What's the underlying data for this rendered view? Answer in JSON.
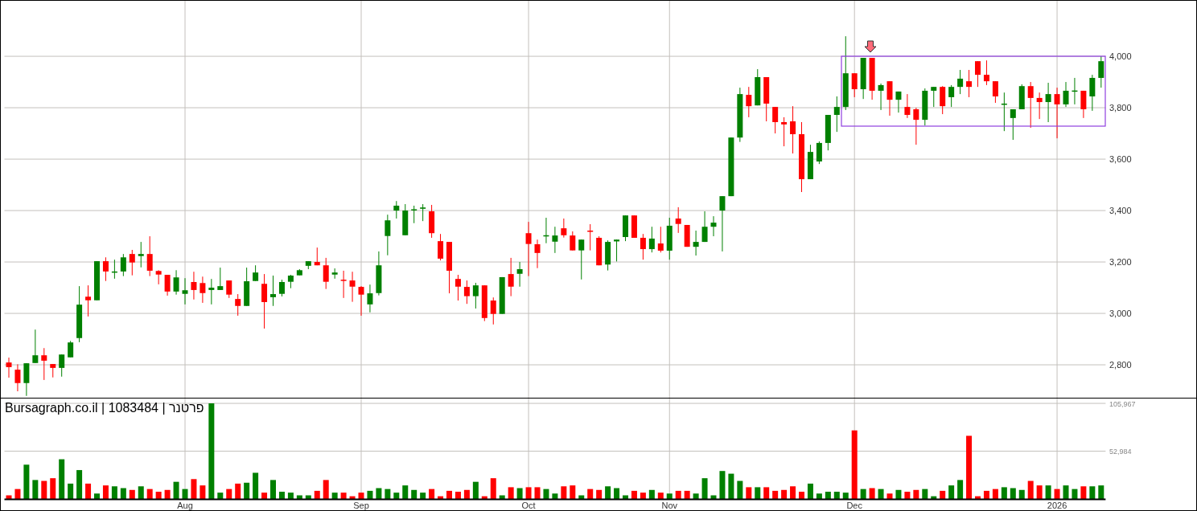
{
  "price_chart": {
    "chart_data": {
      "type": "candlestick",
      "grid": true,
      "ylim": [
        2672,
        4219
      ],
      "yticks": [
        {
          "value": 2800,
          "label": "2,800"
        },
        {
          "value": 3000,
          "label": "3,000"
        },
        {
          "value": 3200,
          "label": "3,200"
        },
        {
          "value": 3400,
          "label": "3,400"
        },
        {
          "value": 3600,
          "label": "3,600"
        },
        {
          "value": 3800,
          "label": "3,800"
        },
        {
          "value": 4000,
          "label": "4,000"
        }
      ],
      "categories": [
        null,
        null,
        null,
        null,
        null,
        null,
        null,
        null,
        null,
        null,
        null,
        null,
        null,
        null,
        null,
        null,
        null,
        null,
        null,
        null,
        null,
        null,
        null,
        null,
        null,
        null,
        null,
        null,
        null,
        null,
        null,
        null,
        null,
        null,
        null,
        null,
        null,
        null,
        null,
        null,
        null,
        null,
        null,
        null,
        null,
        null,
        null,
        null,
        null,
        null,
        null,
        null,
        null,
        null,
        null,
        null,
        null,
        null,
        null,
        null,
        null,
        null,
        null,
        null,
        null,
        null,
        null,
        null,
        null,
        null,
        null,
        null,
        null,
        null,
        null,
        null,
        null,
        null,
        null,
        null,
        null,
        null,
        null,
        null,
        null,
        null,
        null,
        null,
        null,
        null,
        null,
        null,
        null,
        null,
        null,
        null,
        null,
        null,
        null,
        null,
        null,
        null,
        null,
        null,
        null,
        null,
        null,
        null,
        null,
        null,
        null,
        null,
        null,
        null,
        null,
        null,
        null,
        null,
        null,
        null,
        null,
        null,
        null,
        null,
        null
      ],
      "ohlc": [
        [
          2809,
          2828,
          2750,
          2791
        ],
        [
          2781,
          2802,
          2697,
          2729
        ],
        [
          2729,
          2806,
          2679,
          2806
        ],
        [
          2807,
          2937,
          2807,
          2837
        ],
        [
          2837,
          2865,
          2741,
          2816
        ],
        [
          2803,
          2803,
          2751,
          2788
        ],
        [
          2788,
          2840,
          2754,
          2840
        ],
        [
          2829,
          2893,
          2829,
          2887
        ],
        [
          2904,
          3106,
          2888,
          3034
        ],
        [
          3065,
          3109,
          2988,
          3051
        ],
        [
          3051,
          3203,
          3051,
          3203
        ],
        [
          3203,
          3218,
          3126,
          3163
        ],
        [
          3160,
          3209,
          3135,
          3163
        ],
        [
          3163,
          3231,
          3145,
          3218
        ],
        [
          3231,
          3247,
          3148,
          3198
        ],
        [
          3223,
          3278,
          3179,
          3231
        ],
        [
          3231,
          3300,
          3145,
          3166
        ],
        [
          3165,
          3168,
          3113,
          3151
        ],
        [
          3150,
          3150,
          3069,
          3085
        ],
        [
          3085,
          3168,
          3073,
          3140
        ],
        [
          3076,
          3137,
          3035,
          3090
        ],
        [
          3122,
          3162,
          3054,
          3091
        ],
        [
          3118,
          3143,
          3041,
          3079
        ],
        [
          3091,
          3134,
          3035,
          3100
        ],
        [
          3091,
          3178,
          3091,
          3106
        ],
        [
          3128,
          3128,
          3060,
          3073
        ],
        [
          3056,
          3075,
          2991,
          3029
        ],
        [
          3029,
          3178,
          3029,
          3125
        ],
        [
          3126,
          3187,
          3126,
          3159
        ],
        [
          3115,
          3153,
          2941,
          3044
        ],
        [
          3063,
          3147,
          3029,
          3075
        ],
        [
          3076,
          3131,
          3066,
          3122
        ],
        [
          3123,
          3150,
          3098,
          3147
        ],
        [
          3148,
          3172,
          3148,
          3168
        ],
        [
          3185,
          3203,
          3172,
          3203
        ],
        [
          3200,
          3256,
          3187,
          3187
        ],
        [
          3187,
          3216,
          3095,
          3123
        ],
        [
          3151,
          3175,
          3135,
          3159
        ],
        [
          3131,
          3166,
          3060,
          3129
        ],
        [
          3128,
          3162,
          3045,
          3104
        ],
        [
          3103,
          3106,
          2991,
          3073
        ],
        [
          3035,
          3112,
          3004,
          3078
        ],
        [
          3079,
          3241,
          3070,
          3187
        ],
        [
          3301,
          3384,
          3226,
          3362
        ],
        [
          3400,
          3437,
          3369,
          3419
        ],
        [
          3304,
          3425,
          3304,
          3400
        ],
        [
          3401,
          3419,
          3351,
          3405
        ],
        [
          3407,
          3425,
          3359,
          3412
        ],
        [
          3397,
          3422,
          3294,
          3312
        ],
        [
          3281,
          3309,
          3206,
          3213
        ],
        [
          3278,
          3278,
          3078,
          3166
        ],
        [
          3134,
          3150,
          3050,
          3104
        ],
        [
          3103,
          3128,
          3037,
          3067
        ],
        [
          3067,
          3119,
          3019,
          3109
        ],
        [
          3109,
          3109,
          2970,
          2982
        ],
        [
          3050,
          3062,
          2957,
          2998
        ],
        [
          2998,
          3141,
          2998,
          3141
        ],
        [
          3153,
          3216,
          3067,
          3104
        ],
        [
          3154,
          3200,
          3104,
          3172
        ],
        [
          3312,
          3356,
          3145,
          3270
        ],
        [
          3269,
          3287,
          3176,
          3235
        ],
        [
          3302,
          3372,
          3273,
          3304
        ],
        [
          3279,
          3337,
          3235,
          3303
        ],
        [
          3331,
          3369,
          3295,
          3304
        ],
        [
          3303,
          3319,
          3245,
          3245
        ],
        [
          3245,
          3287,
          3132,
          3287
        ],
        [
          3322,
          3347,
          3245,
          3320
        ],
        [
          3294,
          3300,
          3187,
          3187
        ],
        [
          3190,
          3284,
          3167,
          3278
        ],
        [
          3280,
          3287,
          3202,
          3287
        ],
        [
          3297,
          3381,
          3281,
          3381
        ],
        [
          3381,
          3381,
          3294,
          3294
        ],
        [
          3294,
          3309,
          3209,
          3250
        ],
        [
          3250,
          3337,
          3237,
          3291
        ],
        [
          3272,
          3337,
          3237,
          3244
        ],
        [
          3244,
          3372,
          3209,
          3341
        ],
        [
          3369,
          3413,
          3313,
          3348
        ],
        [
          3344,
          3344,
          3259,
          3259
        ],
        [
          3259,
          3322,
          3225,
          3278
        ],
        [
          3278,
          3397,
          3278,
          3337
        ],
        [
          3337,
          3378,
          3300,
          3353
        ],
        [
          3400,
          3456,
          3241,
          3456
        ],
        [
          3456,
          3684,
          3456,
          3684
        ],
        [
          3684,
          3878,
          3667,
          3853
        ],
        [
          3850,
          3881,
          3763,
          3806
        ],
        [
          3809,
          3950,
          3809,
          3919
        ],
        [
          3919,
          3919,
          3747,
          3816
        ],
        [
          3803,
          3803,
          3700,
          3744
        ],
        [
          3744,
          3763,
          3650,
          3735
        ],
        [
          3747,
          3806,
          3622,
          3697
        ],
        [
          3697,
          3744,
          3472,
          3522
        ],
        [
          3522,
          3656,
          3522,
          3628
        ],
        [
          3591,
          3669,
          3581,
          3663
        ],
        [
          3663,
          3772,
          3634,
          3772
        ],
        [
          3772,
          3844,
          3706,
          3803
        ],
        [
          3803,
          4078,
          3791,
          3934
        ],
        [
          3934,
          3934,
          3841,
          3872
        ],
        [
          3872,
          3994,
          3834,
          3994
        ],
        [
          3994,
          3994,
          3831,
          3866
        ],
        [
          3866,
          3894,
          3791,
          3888
        ],
        [
          3903,
          3903,
          3769,
          3831
        ],
        [
          3831,
          3863,
          3781,
          3863
        ],
        [
          3803,
          3853,
          3760,
          3772
        ],
        [
          3794,
          3800,
          3656,
          3753
        ],
        [
          3753,
          3875,
          3731,
          3866
        ],
        [
          3866,
          3881,
          3803,
          3881
        ],
        [
          3881,
          3884,
          3775,
          3806
        ],
        [
          3841,
          3888,
          3803,
          3881
        ],
        [
          3881,
          3947,
          3853,
          3913
        ],
        [
          3903,
          3947,
          3841,
          3881
        ],
        [
          3981,
          3981,
          3881,
          3928
        ],
        [
          3928,
          3984,
          3888,
          3903
        ],
        [
          3903,
          3903,
          3819,
          3844
        ],
        [
          3813,
          3859,
          3709,
          3816
        ],
        [
          3760,
          3794,
          3675,
          3794
        ],
        [
          3794,
          3891,
          3794,
          3884
        ],
        [
          3884,
          3900,
          3722,
          3838
        ],
        [
          3838,
          3859,
          3756,
          3822
        ],
        [
          3822,
          3897,
          3744,
          3853
        ],
        [
          3853,
          3878,
          3681,
          3813
        ],
        [
          3813,
          3900,
          3803,
          3866
        ],
        [
          3865,
          3916,
          3813,
          3867
        ],
        [
          3866,
          3866,
          3760,
          3794
        ],
        [
          3844,
          3928,
          3788,
          3916
        ],
        [
          3916,
          4000,
          3878,
          3981
        ]
      ]
    }
  },
  "volume_chart": {
    "legend": "Bursagraph.co.il | 1083484 | פרטנר",
    "chart_data": {
      "type": "bar",
      "grid": true,
      "ylim": [
        0,
        106000
      ],
      "yticks": [
        {
          "value": 52984,
          "label": "52,984"
        },
        {
          "value": 105967,
          "label": "105,967"
        }
      ],
      "categories": [
        null,
        null,
        null,
        null,
        null,
        null,
        null,
        null,
        null,
        null,
        null,
        null,
        null,
        null,
        null,
        null,
        null,
        null,
        null,
        null,
        "Aug",
        null,
        null,
        null,
        null,
        null,
        null,
        null,
        null,
        null,
        null,
        null,
        null,
        null,
        null,
        null,
        null,
        null,
        null,
        null,
        "Sep",
        null,
        null,
        null,
        null,
        null,
        null,
        null,
        null,
        null,
        null,
        null,
        null,
        null,
        null,
        null,
        null,
        null,
        null,
        "Oct",
        null,
        null,
        null,
        null,
        null,
        null,
        null,
        null,
        null,
        null,
        null,
        null,
        null,
        null,
        null,
        "Nov",
        null,
        null,
        null,
        null,
        null,
        null,
        null,
        null,
        null,
        null,
        null,
        null,
        null,
        null,
        null,
        null,
        null,
        null,
        null,
        null,
        "Dec",
        null,
        null,
        null,
        null,
        null,
        null,
        null,
        null,
        null,
        null,
        null,
        null,
        null,
        null,
        null,
        null,
        null,
        null,
        null,
        null,
        null,
        null,
        "2026",
        null,
        null,
        null,
        null,
        null
      ],
      "series": [
        {
          "values": [
            4000,
            11000,
            38000,
            21000,
            20000,
            23000,
            44000,
            17000,
            32000,
            17000,
            6000,
            15000,
            14000,
            12000,
            10000,
            14000,
            11000,
            8000,
            10000,
            19000,
            11000,
            22000,
            15000,
            106000,
            7000,
            11000,
            17000,
            18000,
            29000,
            7000,
            21000,
            8000,
            7000,
            4000,
            4000,
            9000,
            21000,
            7000,
            7000,
            3000,
            7000,
            9000,
            12000,
            11000,
            7000,
            15000,
            10000,
            7000,
            11000,
            3000,
            9000,
            8000,
            10000,
            19000,
            3000,
            23000,
            4000,
            13000,
            12000,
            13000,
            13000,
            11000,
            6000,
            14000,
            15000,
            4000,
            11000,
            10000,
            14000,
            12000,
            4000,
            9000,
            7000,
            10000,
            7000,
            6000,
            9000,
            9000,
            6000,
            23000,
            4000,
            31000,
            28000,
            20000,
            13000,
            13000,
            13000,
            9000,
            10000,
            14000,
            8000,
            17000,
            6000,
            8000,
            8000,
            7000,
            76000,
            11000,
            12000,
            11000,
            6000,
            10000,
            8000,
            10000,
            11000,
            3000,
            9000,
            15000,
            21000,
            70000,
            3000,
            9000,
            11000,
            13000,
            12000,
            10000,
            20000,
            15000,
            15000,
            11000,
            15000,
            11000,
            14000,
            14000,
            15000
          ]
        }
      ]
    }
  }
}
